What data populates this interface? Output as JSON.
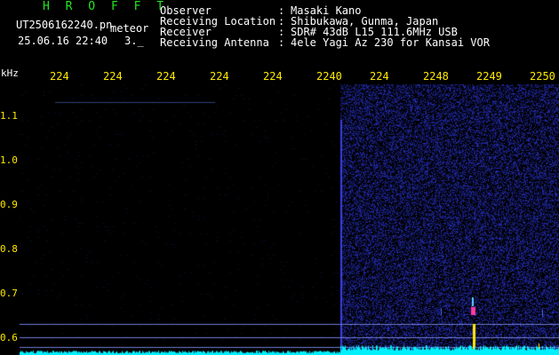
{
  "header": {
    "brand": "H R O F F T",
    "filename": "UT2506162240.pn",
    "mode": "meteor",
    "datetime": "25.06.16 22:40",
    "count": "3._",
    "rows": [
      {
        "label": "Observer",
        "value": "Masaki Kano"
      },
      {
        "label": "Receiving Location",
        "value": "Shibukawa, Gunma, Japan"
      },
      {
        "label": "Receiver",
        "value": "SDR# 43dB L15 111.6MHz USB"
      },
      {
        "label": "Receiving Antenna",
        "value": "4ele Yagi Az 230 for Kansai VOR"
      }
    ]
  },
  "axis": {
    "unit": "kHz",
    "x_ticks": [
      "224",
      "224",
      "224",
      "224",
      "224",
      "2240",
      "224",
      "2248",
      "2249",
      "2250"
    ],
    "y_ticks": [
      "1.1",
      "1.0",
      "0.9",
      "0.8",
      "0.7",
      "0.6"
    ]
  },
  "colors": {
    "background": "#000000",
    "noise": "#2a2fb0",
    "signal": "#ffea00",
    "peak": "#ff3aa0",
    "baseline": "#00f0ff",
    "brand": "#22e81e",
    "axis_text": "#ffea00"
  }
}
